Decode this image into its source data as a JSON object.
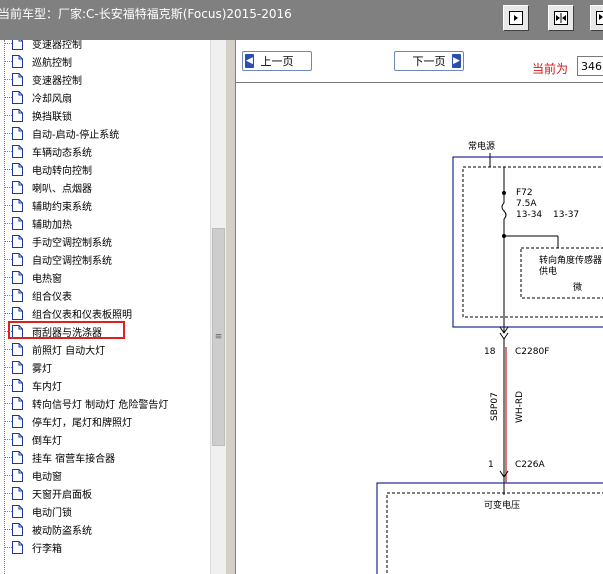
{
  "title": "当前车型：厂家:C-长安福特福克斯(Focus)2015-2016",
  "toolbar": {
    "buttons": [
      "fit-width-icon",
      "fit-page-icon",
      "expand-icon"
    ]
  },
  "tree": {
    "items": [
      "变速器控制",
      "巡航控制",
      "变速器控制",
      "冷却风扇",
      "换挡联锁",
      "自动-启动-停止系统",
      "车辆动态系统",
      "电动转向控制",
      "喇叭、点烟器",
      "辅助约束系统",
      "辅助加热",
      "手动空调控制系统",
      "自动空调控制系统",
      "电热窗",
      "组合仪表",
      "组合仪表和仪表板照明",
      "雨刮器与洗涤器",
      "前照灯  自动大灯",
      "雾灯",
      "车内灯",
      "转向信号灯 制动灯 危险警告灯",
      "停车灯，尾灯和牌照灯",
      "倒车灯",
      "挂车 宿营车接合器",
      "电动窗",
      "天窗开启面板",
      "电动门锁",
      "被动防盗系统",
      "行李箱"
    ],
    "selected": "雨刮器与洗涤器"
  },
  "nav": {
    "prev": "上一页",
    "next": "下一页",
    "current_label": "当前为",
    "current_value": "346"
  },
  "diagram": {
    "power_label": "常电源",
    "fuse_name": "F72",
    "fuse_rating": "7.5A",
    "fuse_ref1": "13-34",
    "fuse_ref2": "13-37",
    "sensor_line1": "转向角度传感器",
    "sensor_line2": "供电",
    "sensor_line3": "微",
    "pin_top": "18",
    "conn_top": "C2280F",
    "circuit": "SBP07",
    "wire_color": "WH-RD",
    "pin_bottom": "1",
    "conn_bottom": "C226A",
    "bottom_box_label": "可变电压"
  }
}
